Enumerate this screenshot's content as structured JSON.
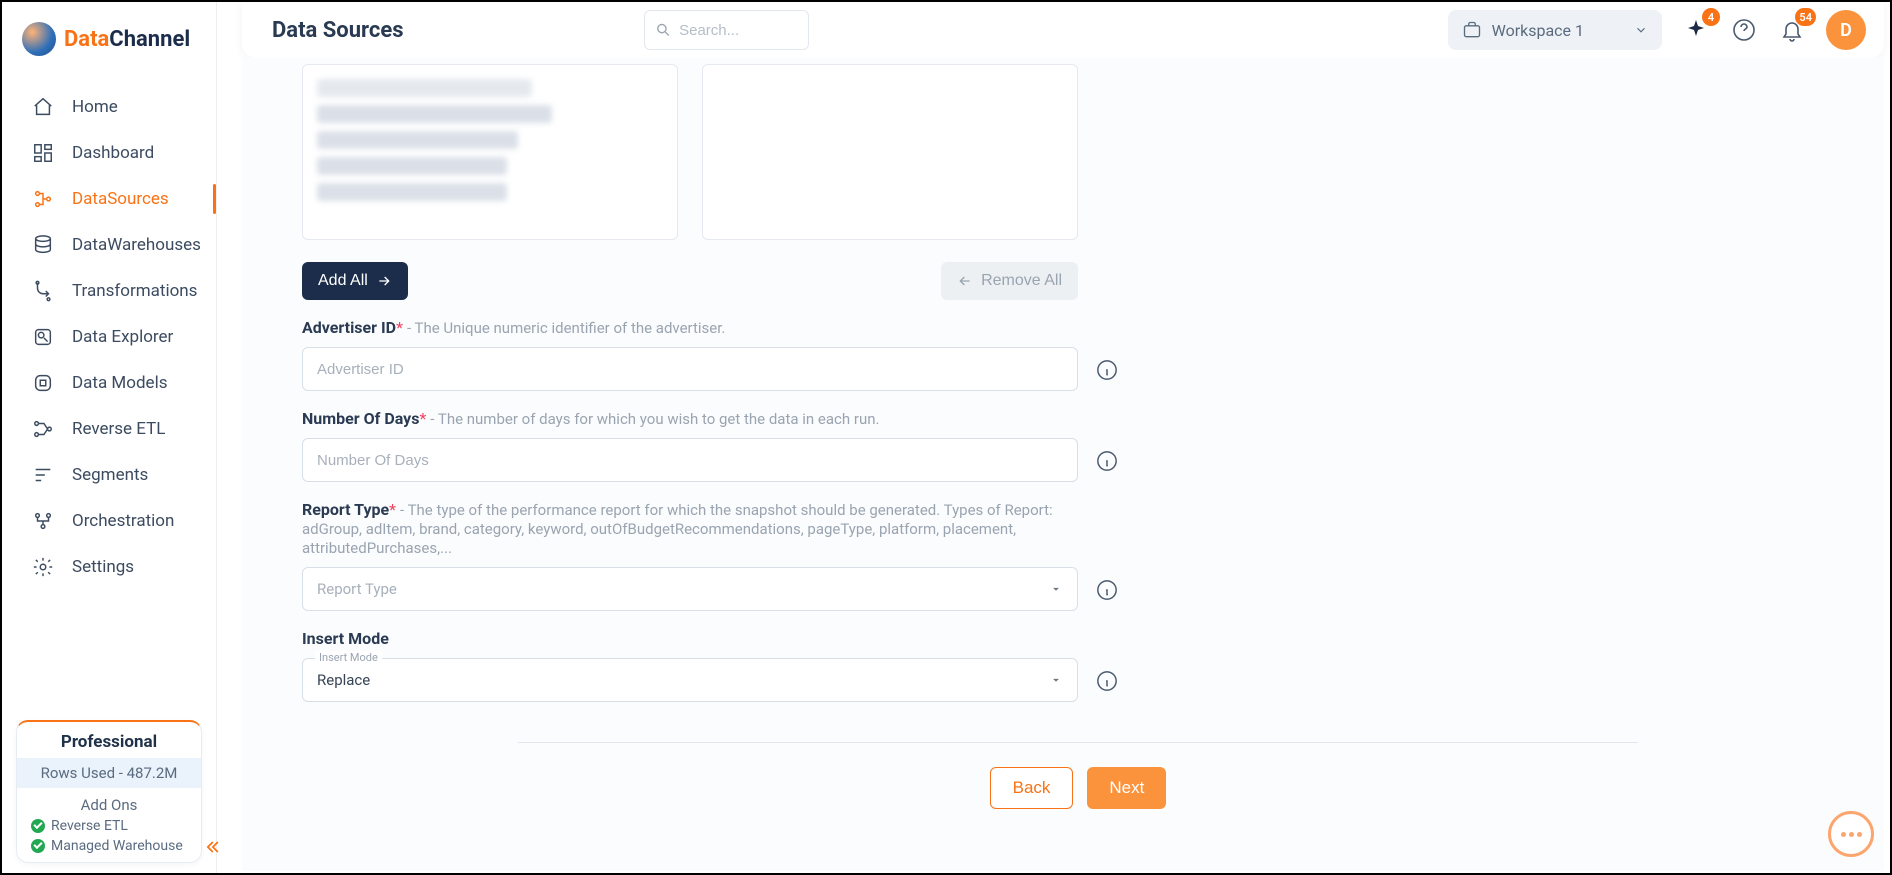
{
  "brand": {
    "name_left": "Data",
    "name_right": "Channel"
  },
  "header": {
    "title": "Data Sources",
    "search_placeholder": "Search...",
    "workspace": "Workspace 1",
    "sparkle_badge": "4",
    "bell_badge": "54",
    "avatar_initial": "D"
  },
  "sidebar": {
    "items": [
      {
        "label": "Home",
        "icon": "home-icon"
      },
      {
        "label": "Dashboard",
        "icon": "dashboard-icon"
      },
      {
        "label": "DataSources",
        "icon": "datasources-icon",
        "active": true
      },
      {
        "label": "DataWarehouses",
        "icon": "datawarehouses-icon"
      },
      {
        "label": "Transformations",
        "icon": "transformations-icon"
      },
      {
        "label": "Data Explorer",
        "icon": "explorer-icon"
      },
      {
        "label": "Data Models",
        "icon": "models-icon"
      },
      {
        "label": "Reverse ETL",
        "icon": "reverse-etl-icon"
      },
      {
        "label": "Segments",
        "icon": "segments-icon"
      },
      {
        "label": "Orchestration",
        "icon": "orchestration-icon"
      },
      {
        "label": "Settings",
        "icon": "settings-icon"
      }
    ]
  },
  "plan_card": {
    "plan": "Professional",
    "rows": "Rows Used - 487.2M",
    "addons_title": "Add Ons",
    "addons": [
      "Reverse ETL",
      "Managed Warehouse"
    ]
  },
  "buttons": {
    "add_all": "Add All",
    "remove_all": "Remove All",
    "back": "Back",
    "next": "Next"
  },
  "form": {
    "advertiser_id": {
      "label": "Advertiser ID",
      "desc": "- The Unique numeric identifier of the advertiser.",
      "placeholder": "Advertiser ID"
    },
    "num_days": {
      "label": "Number Of Days",
      "desc": "- The number of days for which you wish to get the data in each run.",
      "placeholder": "Number Of Days"
    },
    "report_type": {
      "label": "Report Type",
      "desc": "- The type of the performance report for which the snapshot should be generated. Types of Report: adGroup, adItem, brand, category, keyword, outOfBudgetRecommendations, pageType, platform, placement, attributedPurchases,...",
      "placeholder": "Report Type"
    },
    "insert_mode": {
      "label": "Insert Mode",
      "float_label": "Insert Mode",
      "value": "Replace"
    }
  }
}
